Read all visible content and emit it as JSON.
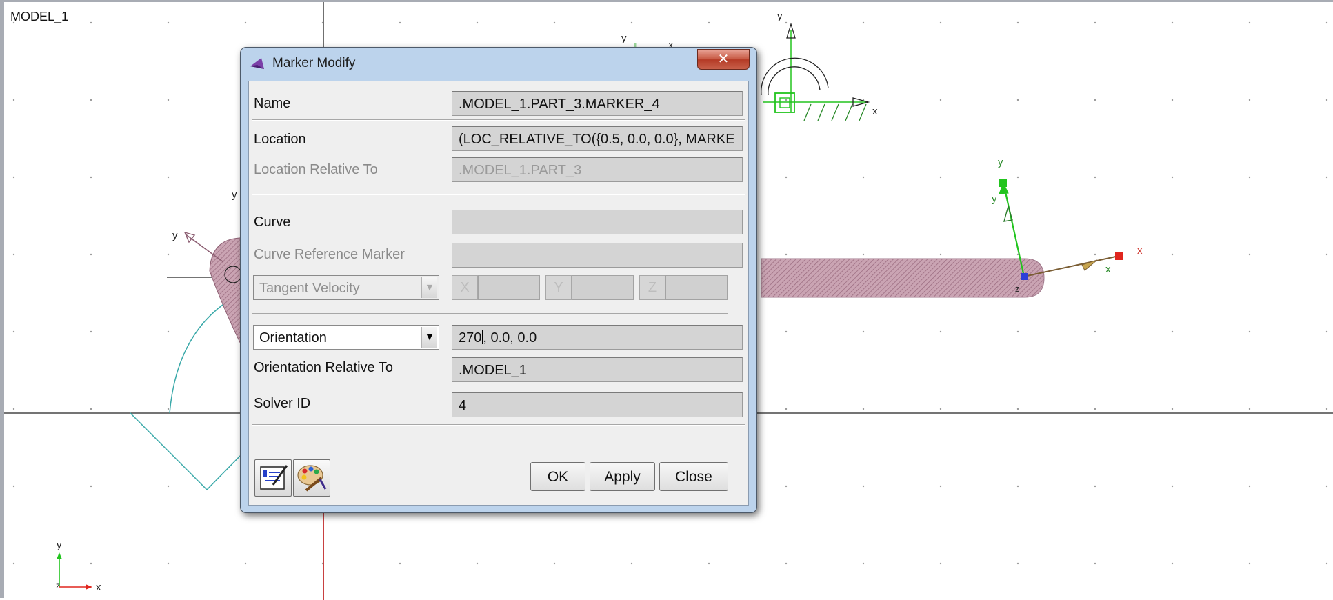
{
  "viewport": {
    "model_name": "MODEL_1",
    "axis_labels": {
      "x": "x",
      "y": "y",
      "z": "z"
    }
  },
  "dialog": {
    "title": "Marker Modify",
    "close_glyph": "✕",
    "fields": {
      "name": {
        "label": "Name",
        "value": ".MODEL_1.PART_3.MARKER_4"
      },
      "location": {
        "label": "Location",
        "value": "(LOC_RELATIVE_TO({0.5, 0.0, 0.0}, MARKE"
      },
      "location_relative_to": {
        "label": "Location Relative To",
        "value": ".MODEL_1.PART_3"
      },
      "curve": {
        "label": "Curve",
        "value": ""
      },
      "curve_reference_marker": {
        "label": "Curve Reference Marker",
        "value": ""
      },
      "tangent_velocity": {
        "selected": "Tangent Velocity",
        "x_label": "X",
        "y_label": "Y",
        "z_label": "Z"
      },
      "orientation": {
        "selected": "Orientation",
        "value_before_caret": "270",
        "value_after_caret": ", 0.0, 0.0"
      },
      "orientation_relative_to": {
        "label": "Orientation Relative To",
        "value": ".MODEL_1"
      },
      "solver_id": {
        "label": "Solver ID",
        "value": "4"
      }
    },
    "buttons": {
      "ok": "OK",
      "apply": "Apply",
      "close": "Close"
    },
    "icons": {
      "window": "adams-logo-icon",
      "comment": "comment-edit-icon",
      "appearance": "palette-brush-icon"
    }
  },
  "colors": {
    "grid_dot": "#9a9a9a",
    "body_fill": "#b88a9c",
    "marker_x": "#e0261e",
    "marker_y": "#22c41e",
    "marker_z": "#2e3fd8",
    "construction": "#3aa9a9"
  }
}
